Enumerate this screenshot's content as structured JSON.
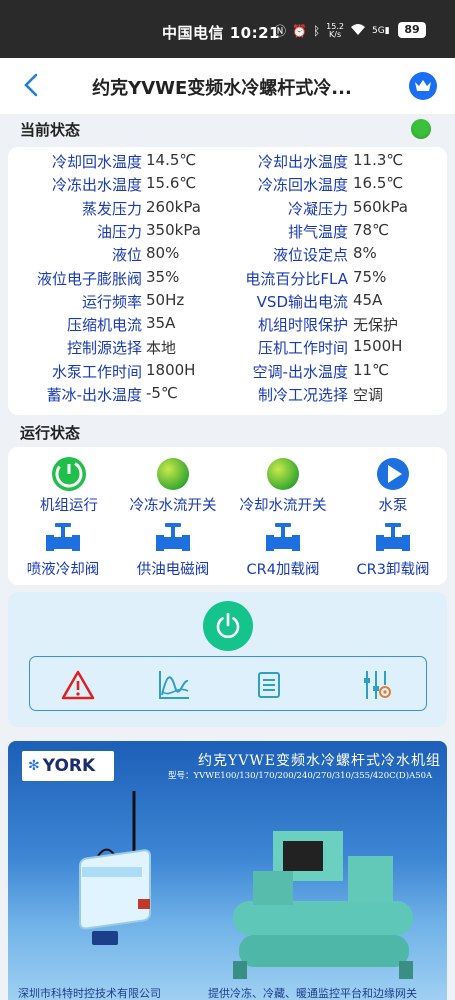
{
  "status_bar": {
    "carrier_time": "中国电信 10:21",
    "net_speed_value": "15.2",
    "net_speed_unit": "K/s",
    "network": "5G",
    "battery": "89"
  },
  "header": {
    "title": "约克YVWE变频水冷螺杆式冷..."
  },
  "current_status": {
    "section_title": "当前状态",
    "indicator_color": "#3cc13c",
    "rows": [
      {
        "label1": "冷却回水温度",
        "value1": "14.5℃",
        "label2": "冷却出水温度",
        "value2": "11.3℃"
      },
      {
        "label1": "冷冻出水温度",
        "value1": "15.6℃",
        "label2": "冷冻回水温度",
        "value2": "16.5℃"
      },
      {
        "label1": "蒸发压力",
        "value1": "260kPa",
        "label2": "冷凝压力",
        "value2": "560kPa"
      },
      {
        "label1": "油压力",
        "value1": "350kPa",
        "label2": "排气温度",
        "value2": "78℃"
      },
      {
        "label1": "液位",
        "value1": "80%",
        "label2": "液位设定点",
        "value2": "8%"
      },
      {
        "label1": "液位电子膨胀阀",
        "value1": "35%",
        "label2": "电流百分比FLA",
        "value2": "75%"
      },
      {
        "label1": "运行频率",
        "value1": "50Hz",
        "label2": "VSD输出电流",
        "value2": "45A"
      },
      {
        "label1": "压缩机电流",
        "value1": "35A",
        "label2": "机组时限保护",
        "value2": "无保护"
      },
      {
        "label1": "控制源选择",
        "value1": "本地",
        "label2": "压机工作时间",
        "value2": "1500H"
      },
      {
        "label1": "水泵工作时间",
        "value1": "1800H",
        "label2": "空调-出水温度",
        "value2": "11℃"
      },
      {
        "label1": "蓄冰-出水温度",
        "value1": "-5℃",
        "label2": "制冷工况选择",
        "value2": "空调"
      }
    ]
  },
  "run_status": {
    "section_title": "运行状态",
    "items": [
      {
        "label": "机组运行",
        "icon": "power-on-icon"
      },
      {
        "label": "冷冻水流开关",
        "icon": "green-ball-icon"
      },
      {
        "label": "冷却水流开关",
        "icon": "green-ball-icon"
      },
      {
        "label": "水泵",
        "icon": "play-icon"
      },
      {
        "label": "喷液冷却阀",
        "icon": "valve-icon"
      },
      {
        "label": "供油电磁阀",
        "icon": "valve-icon"
      },
      {
        "label": "CR4加载阀",
        "icon": "valve-icon"
      },
      {
        "label": "CR3卸载阀",
        "icon": "valve-icon"
      }
    ]
  },
  "controls": {
    "power_icon": "power-icon",
    "tools": [
      "warning-icon",
      "trend-chart-icon",
      "list-icon",
      "settings-sliders-icon"
    ]
  },
  "banner": {
    "brand": "YORK",
    "title": "约克YVWE变频水冷螺杆式冷水机组",
    "model": "型号：YVWE100/130/170/200/240/270/310/355/420C(D)A50A",
    "footer_left": "深圳市科特时控技术有限公司",
    "footer_right": "提供冷冻、冷藏、暖通监控平台和边缘网关"
  }
}
